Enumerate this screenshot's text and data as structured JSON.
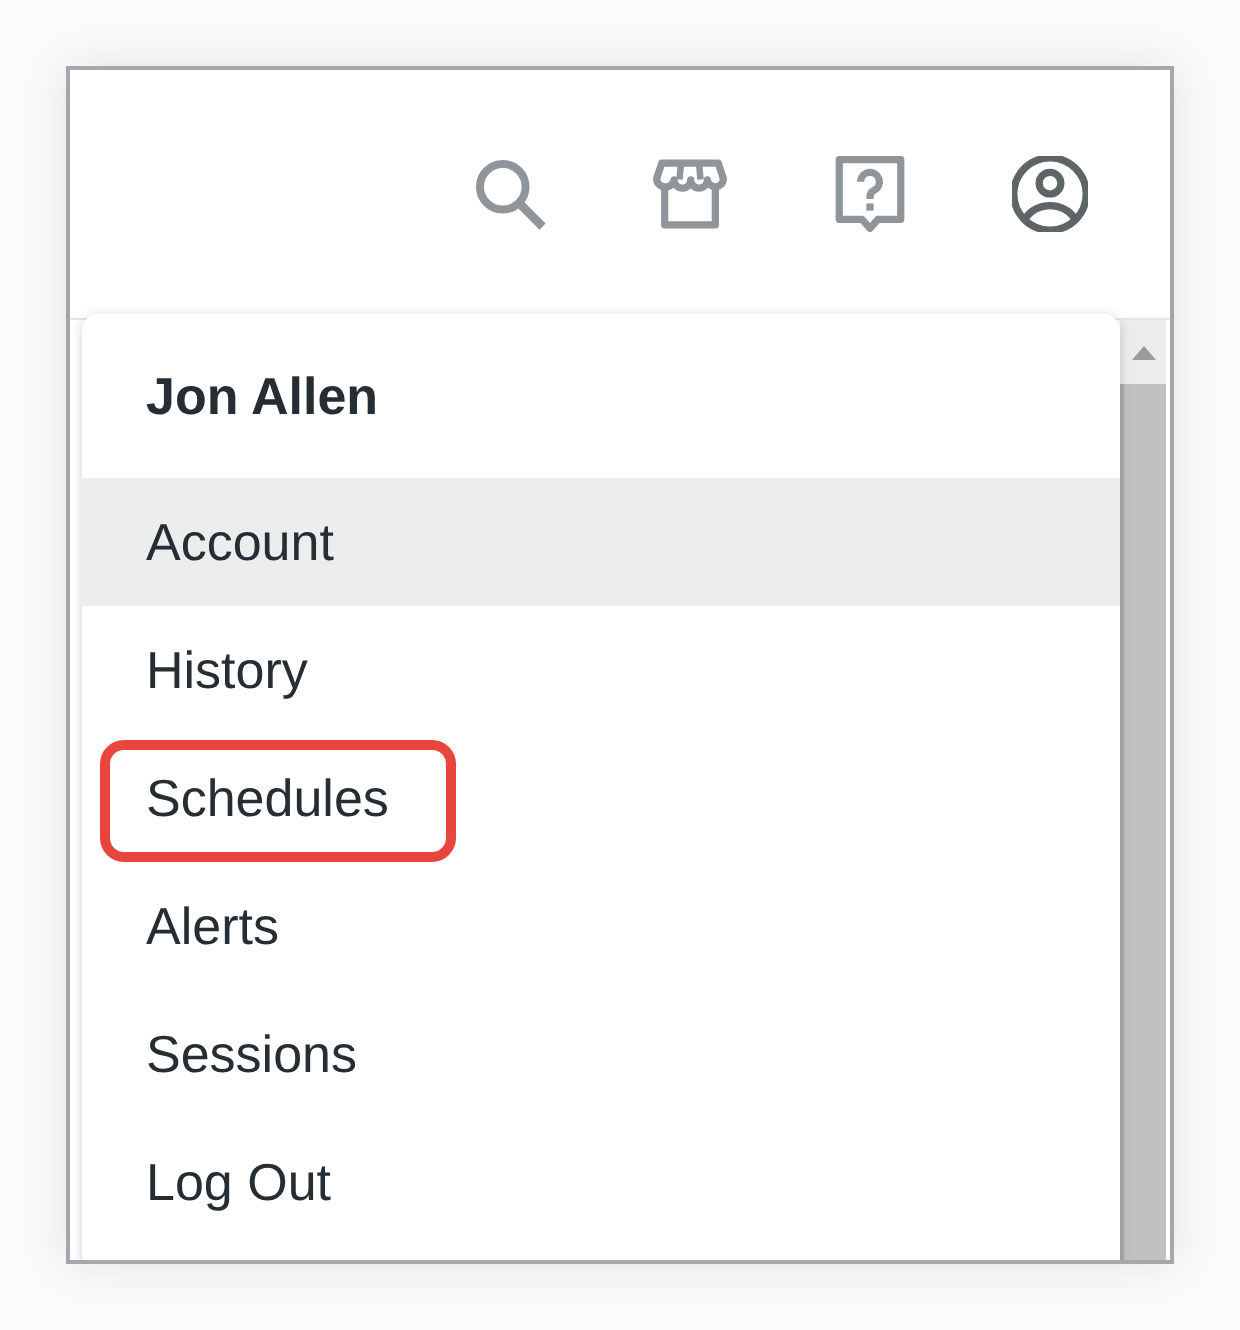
{
  "header": {
    "icons": [
      {
        "kind": "search",
        "active": false
      },
      {
        "kind": "store",
        "active": false
      },
      {
        "kind": "help",
        "active": false
      },
      {
        "kind": "account",
        "active": true
      }
    ]
  },
  "user_menu": {
    "user_name": "Jon Allen",
    "items": [
      {
        "label": "Account",
        "selected": true,
        "callout": false
      },
      {
        "label": "History",
        "selected": false,
        "callout": false
      },
      {
        "label": "Schedules",
        "selected": false,
        "callout": true
      },
      {
        "label": "Alerts",
        "selected": false,
        "callout": false
      },
      {
        "label": "Sessions",
        "selected": false,
        "callout": false
      },
      {
        "label": "Log Out",
        "selected": false,
        "callout": false
      }
    ]
  }
}
